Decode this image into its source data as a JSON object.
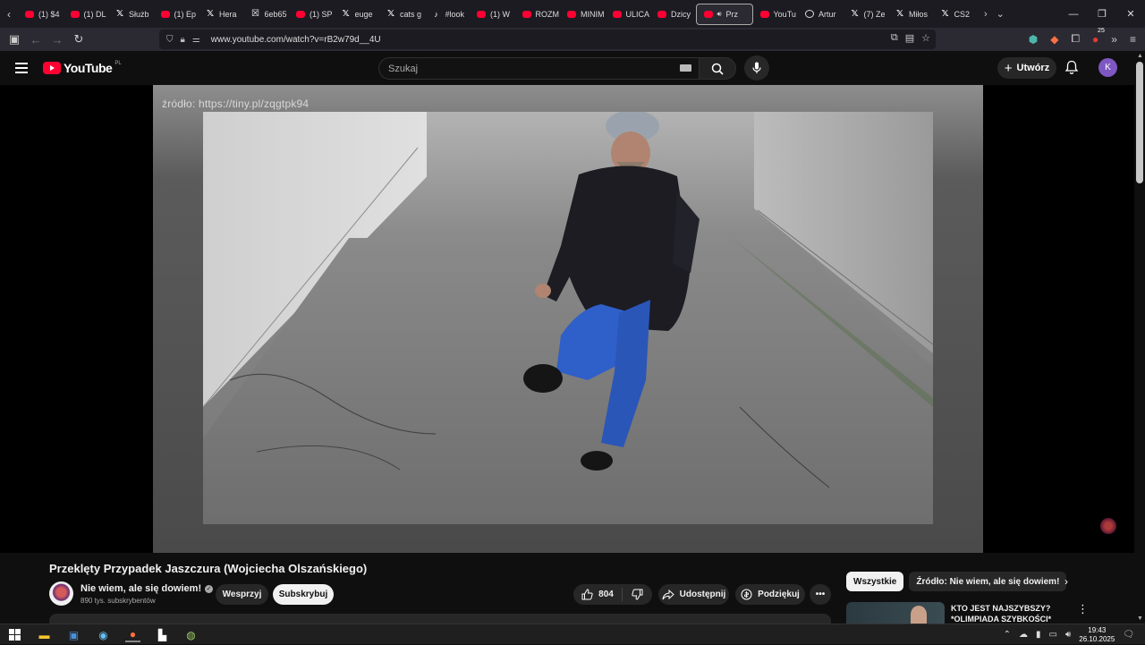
{
  "browser": {
    "tabs": [
      {
        "label": "(1) $4",
        "icon": "youtube"
      },
      {
        "label": "(1) DL",
        "icon": "youtube"
      },
      {
        "label": "Służb",
        "icon": "x"
      },
      {
        "label": "(1) Ep",
        "icon": "youtube"
      },
      {
        "label": "Hera",
        "icon": "x"
      },
      {
        "label": "6eb65",
        "icon": "x-box"
      },
      {
        "label": "(1) SP",
        "icon": "youtube"
      },
      {
        "label": "euge",
        "icon": "x"
      },
      {
        "label": "cats g",
        "icon": "x"
      },
      {
        "label": "#look",
        "icon": "tiktok"
      },
      {
        "label": "(1) W",
        "icon": "youtube"
      },
      {
        "label": "ROZM",
        "icon": "youtube"
      },
      {
        "label": "MINIM",
        "icon": "youtube"
      },
      {
        "label": "ULICA",
        "icon": "youtube"
      },
      {
        "label": "Dzicy",
        "icon": "youtube"
      },
      {
        "label": "Prz",
        "icon": "youtube",
        "active": true
      },
      {
        "label": "YouTu",
        "icon": "youtube"
      },
      {
        "label": "Artur",
        "icon": "chrome"
      },
      {
        "label": "(7) Ze",
        "icon": "x"
      },
      {
        "label": "Miłos",
        "icon": "x"
      },
      {
        "label": "CS2",
        "icon": "x"
      }
    ],
    "url": "www.youtube.com/watch?v=rB2w79d__4U",
    "extension_badge": "25"
  },
  "youtube": {
    "logo_text": "YouTube",
    "region": "PL",
    "search_placeholder": "Szukaj",
    "create_label": "Utwórz",
    "avatar_letter": "K"
  },
  "video": {
    "watermark_source": "źródło: https://tiny.pl/zqgtpk94",
    "title": "Przeklęty Przypadek Jaszczura (Wojciecha Olszańskiego)",
    "channel_name": "Nie wiem, ale się dowiem!",
    "subscribers": "890 tys. subskrybentów",
    "support_label": "Wesprzyj",
    "subscribe_label": "Subskrybuj",
    "likes": "804",
    "share_label": "Udostępnij",
    "thanks_label": "Podziękuj"
  },
  "sidebar": {
    "chips": [
      "Wszystkie",
      "Źródło: Nie wiem, ale się dowiem!"
    ],
    "reco_title": "KTO JEST NAJSZYBSZY? *OLIMPIADA SZYBKOŚCI*"
  },
  "taskbar": {
    "time": "19:43",
    "date": "26.10.2025"
  }
}
